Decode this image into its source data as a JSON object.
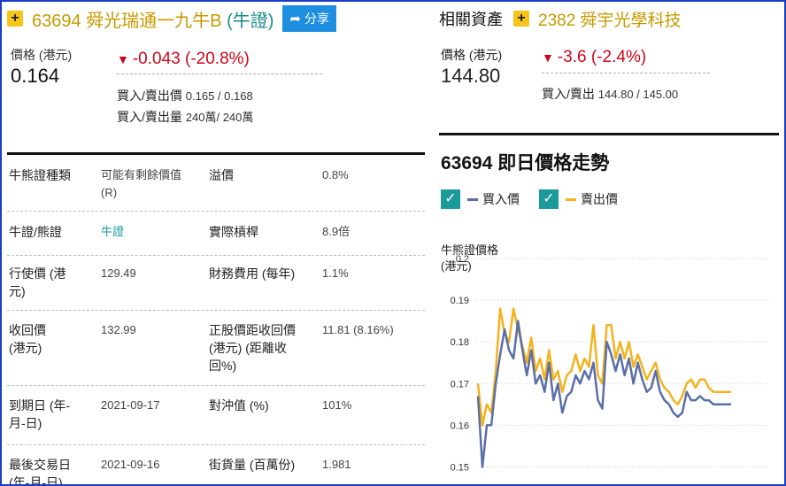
{
  "main": {
    "add_symbol": "+",
    "code": "63694",
    "name": "舜光瑞通一九牛B",
    "category": "(牛證)",
    "share_label": "分享",
    "price_label": "價格 (港元)",
    "price": "0.164",
    "change": "-0.043 (-20.8%)",
    "bid_ask_label": "買入/賣出價",
    "bid_ask_value": "0.165 / 0.168",
    "bid_ask_vol_label": "買入/賣出量",
    "bid_ask_vol_value": "240萬/ 240萬"
  },
  "info": {
    "rows": [
      {
        "k1": "牛熊證種類",
        "v1": "可能有剩餘價值 (R)",
        "k2": "溢價",
        "v2": "0.8%"
      },
      {
        "k1": "牛證/熊證",
        "v1": "牛證",
        "k2": "實際槓桿",
        "v2": "8.9倍"
      },
      {
        "k1": "行使價 (港元)",
        "v1": "129.49",
        "k2": "財務費用 (每年)",
        "v2": "1.1%"
      },
      {
        "k1": "收回價 (港元)",
        "v1": "132.99",
        "k2": "正股價距收回價 (港元) (距離收回%)",
        "v2": "11.81 (8.16%)"
      },
      {
        "k1": "到期日 (年-月-日)",
        "v1": "2021-09-17",
        "k2": "對沖值 (%)",
        "v2": "101%"
      },
      {
        "k1": "最後交易日 (年-月-日)",
        "v1": "2021-09-16",
        "k2": "街貨量 (百萬份)",
        "v2": "1.981"
      }
    ]
  },
  "related": {
    "label": "相關資產",
    "add_symbol": "+",
    "stock": "2382 舜宇光學科技",
    "price_label": "價格 (港元)",
    "price": "144.80",
    "change": "-3.6 (-2.4%)",
    "bid_ask_label": "買入/賣出",
    "bid_ask_value": "144.80 / 145.00"
  },
  "chart_section": {
    "title": "63694 即日價格走勢",
    "check_symbol": "✓",
    "colors": {
      "bid": "#5a6fa8",
      "ask": "#f5b21e",
      "check": "#1a9a9a",
      "down": "#d0021b"
    }
  },
  "chart_data": {
    "type": "line",
    "ylabel_1": "牛熊證價格",
    "ylabel_2": "(港元)",
    "ylim": [
      0.145,
      0.2
    ],
    "yticks": [
      "0.2",
      "0.19",
      "0.18",
      "0.17",
      "0.16",
      "0.15"
    ],
    "series": [
      {
        "name": "買入價",
        "key": "bid",
        "values": [
          0.167,
          0.15,
          0.16,
          0.16,
          0.17,
          0.177,
          0.183,
          0.178,
          0.176,
          0.185,
          0.178,
          0.172,
          0.178,
          0.17,
          0.172,
          0.168,
          0.175,
          0.166,
          0.17,
          0.163,
          0.167,
          0.168,
          0.172,
          0.17,
          0.173,
          0.171,
          0.175,
          0.166,
          0.164,
          0.18,
          0.177,
          0.173,
          0.177,
          0.172,
          0.176,
          0.17,
          0.175,
          0.171,
          0.168,
          0.169,
          0.173,
          0.168,
          0.166,
          0.165,
          0.163,
          0.162,
          0.163,
          0.168,
          0.166,
          0.166,
          0.167,
          0.166,
          0.166,
          0.165,
          0.165,
          0.165,
          0.165,
          0.165
        ]
      },
      {
        "name": "賣出價",
        "key": "ask",
        "values": [
          0.17,
          0.16,
          0.165,
          0.163,
          0.173,
          0.188,
          0.182,
          0.18,
          0.188,
          0.183,
          0.179,
          0.175,
          0.181,
          0.173,
          0.176,
          0.171,
          0.178,
          0.171,
          0.173,
          0.168,
          0.172,
          0.173,
          0.177,
          0.173,
          0.176,
          0.174,
          0.184,
          0.172,
          0.17,
          0.184,
          0.184,
          0.176,
          0.18,
          0.176,
          0.18,
          0.174,
          0.177,
          0.174,
          0.171,
          0.173,
          0.175,
          0.171,
          0.169,
          0.168,
          0.166,
          0.165,
          0.167,
          0.17,
          0.171,
          0.169,
          0.171,
          0.171,
          0.169,
          0.168,
          0.168,
          0.168,
          0.168,
          0.168
        ]
      }
    ]
  }
}
